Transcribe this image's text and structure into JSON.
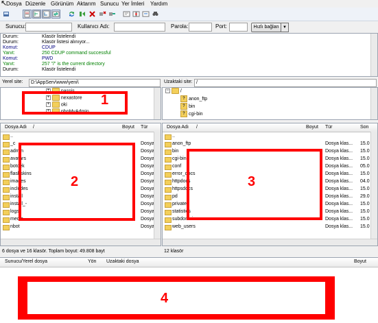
{
  "menu": [
    "Dosya",
    "Düzenle",
    "Görünüm",
    "Aktarım",
    "Sunucu",
    "Yer İmleri",
    "Yardım"
  ],
  "toolbar_icons": [
    "site-manager-icon",
    "toggle-log-icon",
    "toggle-local-tree-icon",
    "toggle-remote-tree-icon",
    "toggle-queue-icon",
    "refresh-icon",
    "process-queue-icon",
    "cancel-icon",
    "disconnect-icon",
    "reconnect-icon",
    "filter-icon",
    "compare-icon",
    "sync-browse-icon",
    "search-icon"
  ],
  "quickconnect": {
    "host_label": "Sunucu:",
    "user_label": "Kullanıcı Adı:",
    "pass_label": "Parola:",
    "port_label": "Port:",
    "button": "Hızlı bağlan"
  },
  "log": [
    {
      "k": "Durum:",
      "m": "Klasör listelendi",
      "c": "#000000"
    },
    {
      "k": "Durum:",
      "m": "Klasör listesi alınıyor...",
      "c": "#000000"
    },
    {
      "k": "Komut:",
      "m": "CDUP",
      "c": "#000080"
    },
    {
      "k": "Yanıt:",
      "m": "250 CDUP command successful",
      "c": "#008000"
    },
    {
      "k": "Komut:",
      "m": "PWD",
      "c": "#000080"
    },
    {
      "k": "Yanıt:",
      "m": "257 \"/\" is the current directory",
      "c": "#008000"
    },
    {
      "k": "Durum:",
      "m": "Klasör listelendi",
      "c": "#000000"
    }
  ],
  "local": {
    "site_label": "Yerel site:",
    "path": "D:\\AppServ\\www\\yeni\\",
    "tree": [
      "nassis",
      "nexastore",
      "oki",
      "phpMyAdmin"
    ],
    "headers": [
      "Dosya Adı",
      "/",
      "Boyut",
      "Tür"
    ],
    "files": [
      "..",
      "_c",
      "admin",
      "avatars",
      "botcek",
      "flashskins",
      "images",
      "includes",
      "install",
      "install_-",
      "logs",
      "media",
      "nbot"
    ],
    "type": "Dosya",
    "status": "6 dosya ve 16 klasör. Toplam boyut: 49.808 bayt"
  },
  "remote": {
    "site_label": "Uzaktaki site:",
    "path": "/",
    "tree": [
      "/",
      "anon_ftp",
      "bin",
      "cgi-bin"
    ],
    "headers": [
      "Dosya Adı",
      "/",
      "Boyut",
      "Tür",
      "Son"
    ],
    "files": [
      {
        "name": "..",
        "type": "",
        "date": ""
      },
      {
        "name": "anon_ftp",
        "type": "Dosya klas...",
        "date": "15.0"
      },
      {
        "name": "bin",
        "type": "Dosya klas...",
        "date": "15.0"
      },
      {
        "name": "cgi-bin",
        "type": "Dosya klas...",
        "date": "15.0"
      },
      {
        "name": "conf",
        "type": "Dosya klas...",
        "date": "05.0"
      },
      {
        "name": "error_docs",
        "type": "Dosya klas...",
        "date": "15.0"
      },
      {
        "name": "httpdocs",
        "type": "Dosya klas...",
        "date": "04.0"
      },
      {
        "name": "httpsdocs",
        "type": "Dosya klas...",
        "date": "15.0"
      },
      {
        "name": "pd",
        "type": "Dosya klas...",
        "date": "29.0"
      },
      {
        "name": "private",
        "type": "Dosya klas...",
        "date": "15.0"
      },
      {
        "name": "statistics",
        "type": "Dosya klas...",
        "date": "15.0"
      },
      {
        "name": "subdomains",
        "type": "Dosya klas...",
        "date": "15.0"
      },
      {
        "name": "web_users",
        "type": "Dosya klas...",
        "date": "15.0"
      }
    ],
    "status": "12 klasör"
  },
  "queue": {
    "headers": [
      "Sunucu/Yerel dosya",
      "Yön",
      "Uzaktaki dosya",
      "Boyut"
    ]
  },
  "annotations": [
    "1",
    "2",
    "3",
    "4"
  ]
}
